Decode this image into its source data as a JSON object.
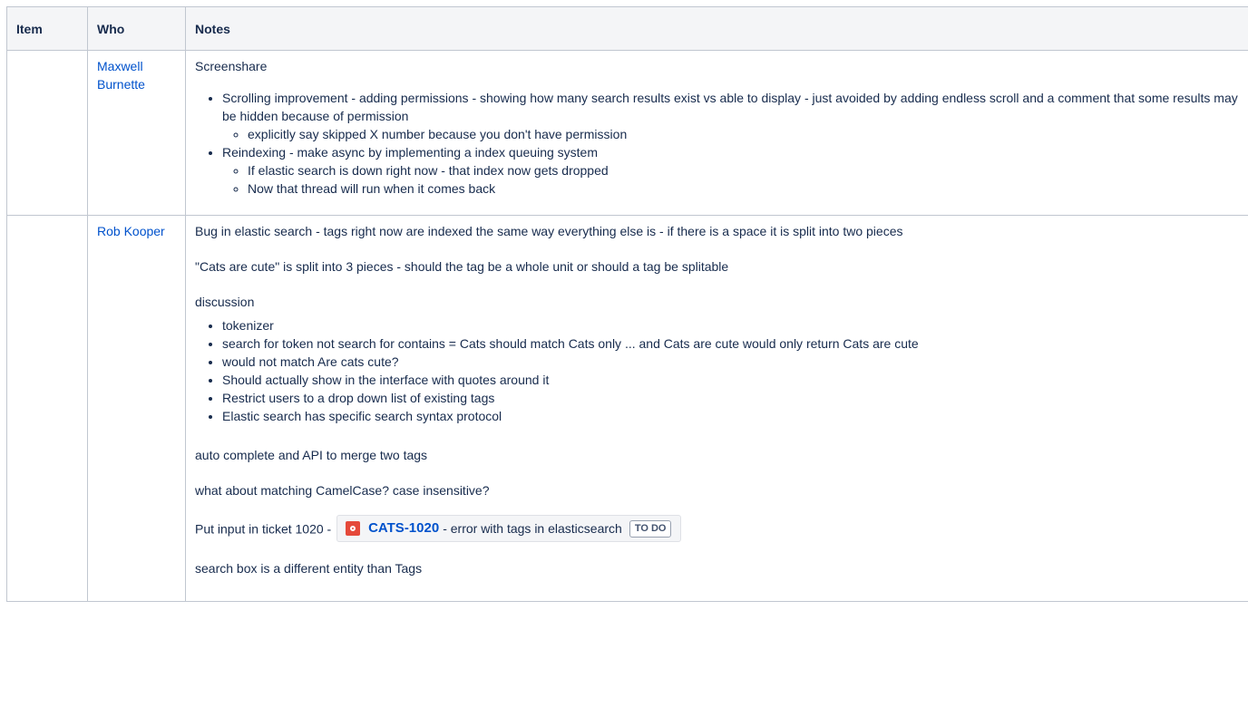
{
  "table": {
    "headers": [
      "Item",
      "Who",
      "Notes"
    ]
  },
  "rows": [
    {
      "who": "Maxwell Burnette",
      "intro": "Screenshare",
      "bullets": [
        {
          "text": "Scrolling improvement - adding permissions - showing how many search results exist vs able to display - just avoided by adding endless scroll and a comment that some results may be hidden because of permission",
          "sub": [
            "explicitly say skipped X number because you don't have permission"
          ]
        },
        {
          "text": "Reindexing - make async by implementing a index queuing system",
          "sub": [
            "If elastic search is down right now - that index now gets dropped",
            "Now that thread will run when it comes back"
          ]
        }
      ]
    },
    {
      "who": "Rob Kooper",
      "paragraphs_before": [
        "Bug in elastic search - tags right now are indexed the same way everything else is - if there is a space it is split into two pieces",
        "\"Cats are cute\" is split into 3 pieces - should the tag be a whole unit or should a tag be splitable",
        "discussion"
      ],
      "bullets": [
        "tokenizer",
        "search for token not search for contains = Cats should match Cats only ... and Cats are cute would only return Cats are cute",
        "would not match Are cats cute?",
        "Should actually show in the interface with quotes around it",
        "Restrict users to a drop down list of existing tags",
        "Elastic search has specific search syntax protocol"
      ],
      "paragraphs_after": [
        "auto complete and API to merge two tags",
        "what about matching CamelCase? case insensitive?"
      ],
      "ticket_line": {
        "prefix": "Put input in ticket 1020 - ",
        "issue_key": "CATS-1020",
        "issue_summary": "- error with tags in elasticsearch",
        "status": "TO DO",
        "icon": "bug-icon"
      },
      "last_paragraph": "search box is a different entity than Tags"
    }
  ],
  "colors": {
    "link": "#0052cc",
    "header_bg": "#f4f5f7",
    "border": "#c1c7d0",
    "bug_icon": "#e5493a"
  }
}
